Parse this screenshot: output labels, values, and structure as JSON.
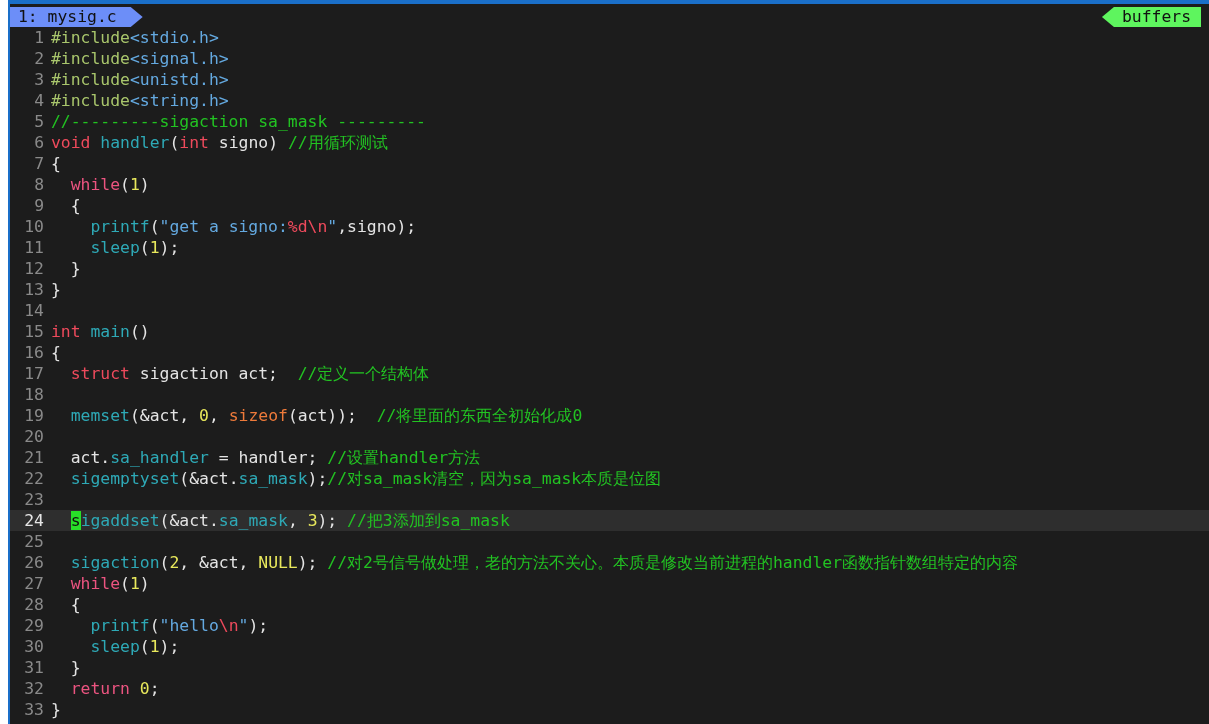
{
  "tabline": {
    "tabs": [
      {
        "label": "1: mysig.c",
        "selected": true
      }
    ],
    "buffers_label": "buffers"
  },
  "lines": [
    {
      "number": "1",
      "current": false,
      "tokens": [
        {
          "kind": "preproc",
          "text": "#include"
        },
        {
          "kind": "string",
          "text": "<stdio.h>"
        }
      ]
    },
    {
      "number": "2",
      "current": false,
      "tokens": [
        {
          "kind": "preproc",
          "text": "#include"
        },
        {
          "kind": "string",
          "text": "<signal.h>"
        }
      ]
    },
    {
      "number": "3",
      "current": false,
      "tokens": [
        {
          "kind": "preproc",
          "text": "#include"
        },
        {
          "kind": "string",
          "text": "<unistd.h>"
        }
      ]
    },
    {
      "number": "4",
      "current": false,
      "tokens": [
        {
          "kind": "preproc",
          "text": "#include"
        },
        {
          "kind": "string",
          "text": "<string.h>"
        }
      ]
    },
    {
      "number": "5",
      "current": false,
      "tokens": [
        {
          "kind": "comment",
          "text": "//---------sigaction sa_mask ---------"
        }
      ]
    },
    {
      "number": "6",
      "current": false,
      "tokens": [
        {
          "kind": "type",
          "text": "void"
        },
        {
          "kind": "func",
          "text": " handler"
        },
        {
          "kind": "plain",
          "text": "("
        },
        {
          "kind": "type",
          "text": "int"
        },
        {
          "kind": "plain",
          "text": " signo) "
        },
        {
          "kind": "comment",
          "text": "//用循环测试"
        }
      ]
    },
    {
      "number": "7",
      "current": false,
      "tokens": [
        {
          "kind": "plain",
          "text": "{"
        }
      ]
    },
    {
      "number": "8",
      "current": false,
      "tokens": [
        {
          "kind": "keyword",
          "text": "  while"
        },
        {
          "kind": "plain",
          "text": "("
        },
        {
          "kind": "number",
          "text": "1"
        },
        {
          "kind": "plain",
          "text": ")"
        }
      ]
    },
    {
      "number": "9",
      "current": false,
      "tokens": [
        {
          "kind": "plain",
          "text": "  {"
        }
      ]
    },
    {
      "number": "10",
      "current": false,
      "tokens": [
        {
          "kind": "func",
          "text": "    printf"
        },
        {
          "kind": "plain",
          "text": "("
        },
        {
          "kind": "string",
          "text": "\"get a signo:"
        },
        {
          "kind": "escape",
          "text": "%d\\n"
        },
        {
          "kind": "string",
          "text": "\""
        },
        {
          "kind": "plain",
          "text": ",signo);"
        }
      ]
    },
    {
      "number": "11",
      "current": false,
      "tokens": [
        {
          "kind": "func",
          "text": "    sleep"
        },
        {
          "kind": "plain",
          "text": "("
        },
        {
          "kind": "number",
          "text": "1"
        },
        {
          "kind": "plain",
          "text": ");"
        }
      ]
    },
    {
      "number": "12",
      "current": false,
      "tokens": [
        {
          "kind": "plain",
          "text": "  }"
        }
      ]
    },
    {
      "number": "13",
      "current": false,
      "tokens": [
        {
          "kind": "plain",
          "text": "}"
        }
      ]
    },
    {
      "number": "14",
      "current": false
    },
    {
      "number": "15",
      "current": false,
      "tokens": [
        {
          "kind": "type",
          "text": "int"
        },
        {
          "kind": "func",
          "text": " main"
        },
        {
          "kind": "plain",
          "text": "()"
        }
      ]
    },
    {
      "number": "16",
      "current": false,
      "tokens": [
        {
          "kind": "plain",
          "text": "{"
        }
      ]
    },
    {
      "number": "17",
      "current": false,
      "tokens": [
        {
          "kind": "type",
          "text": "  struct"
        },
        {
          "kind": "plain",
          "text": " sigaction act;  "
        },
        {
          "kind": "comment",
          "text": "//定义一个结构体"
        }
      ]
    },
    {
      "number": "18",
      "current": false
    },
    {
      "number": "19",
      "current": false,
      "tokens": [
        {
          "kind": "func",
          "text": "  memset"
        },
        {
          "kind": "plain",
          "text": "(&act, "
        },
        {
          "kind": "number",
          "text": "0"
        },
        {
          "kind": "plain",
          "text": ", "
        },
        {
          "kind": "operator",
          "text": "sizeof"
        },
        {
          "kind": "plain",
          "text": "(act));  "
        },
        {
          "kind": "comment",
          "text": "//将里面的东西全初始化成0"
        }
      ]
    },
    {
      "number": "20",
      "current": false
    },
    {
      "number": "21",
      "current": false,
      "tokens": [
        {
          "kind": "plain",
          "text": "  act."
        },
        {
          "kind": "field",
          "text": "sa_handler"
        },
        {
          "kind": "plain",
          "text": " = handler; "
        },
        {
          "kind": "comment",
          "text": "//设置handler方法"
        }
      ]
    },
    {
      "number": "22",
      "current": false,
      "tokens": [
        {
          "kind": "func",
          "text": "  sigemptyset"
        },
        {
          "kind": "plain",
          "text": "(&act."
        },
        {
          "kind": "field",
          "text": "sa_mask"
        },
        {
          "kind": "plain",
          "text": ");"
        },
        {
          "kind": "comment",
          "text": "//对sa_mask清空，因为sa_mask本质是位图"
        }
      ]
    },
    {
      "number": "23",
      "current": false
    },
    {
      "number": "24",
      "current": true,
      "tokens": [
        {
          "kind": "cursor",
          "text": "s"
        },
        {
          "kind": "func",
          "text": "igaddset"
        },
        {
          "kind": "plain",
          "text": "(&act."
        },
        {
          "kind": "field",
          "text": "sa_mask"
        },
        {
          "kind": "plain",
          "text": ", "
        },
        {
          "kind": "number",
          "text": "3"
        },
        {
          "kind": "plain",
          "text": "); "
        },
        {
          "kind": "comment",
          "text": "//把3添加到sa_mask"
        }
      ]
    },
    {
      "number": "25",
      "current": false
    },
    {
      "number": "26",
      "current": false,
      "tokens": [
        {
          "kind": "func",
          "text": "  sigaction"
        },
        {
          "kind": "plain",
          "text": "("
        },
        {
          "kind": "number",
          "text": "2"
        },
        {
          "kind": "plain",
          "text": ", &act, "
        },
        {
          "kind": "number",
          "text": "NULL"
        },
        {
          "kind": "plain",
          "text": "); "
        },
        {
          "kind": "comment",
          "text": "//对2号信号做处理，老的方法不关心。本质是修改当前进程的handler函数指针数组特定的内容"
        }
      ]
    },
    {
      "number": "27",
      "current": false,
      "tokens": [
        {
          "kind": "keyword",
          "text": "  while"
        },
        {
          "kind": "plain",
          "text": "("
        },
        {
          "kind": "number",
          "text": "1"
        },
        {
          "kind": "plain",
          "text": ")"
        }
      ]
    },
    {
      "number": "28",
      "current": false,
      "tokens": [
        {
          "kind": "plain",
          "text": "  {"
        }
      ]
    },
    {
      "number": "29",
      "current": false,
      "tokens": [
        {
          "kind": "func",
          "text": "    printf"
        },
        {
          "kind": "plain",
          "text": "("
        },
        {
          "kind": "string",
          "text": "\"hello"
        },
        {
          "kind": "escape",
          "text": "\\n"
        },
        {
          "kind": "string",
          "text": "\""
        },
        {
          "kind": "plain",
          "text": ");"
        }
      ]
    },
    {
      "number": "30",
      "current": false,
      "tokens": [
        {
          "kind": "func",
          "text": "    sleep"
        },
        {
          "kind": "plain",
          "text": "("
        },
        {
          "kind": "number",
          "text": "1"
        },
        {
          "kind": "plain",
          "text": ");"
        }
      ]
    },
    {
      "number": "31",
      "current": false,
      "tokens": [
        {
          "kind": "plain",
          "text": "  }"
        }
      ]
    },
    {
      "number": "32",
      "current": false,
      "tokens": [
        {
          "kind": "keyword",
          "text": "  return"
        },
        {
          "kind": "number",
          "text": " 0"
        },
        {
          "kind": "plain",
          "text": ";"
        }
      ]
    },
    {
      "number": "33",
      "current": false,
      "tokens": [
        {
          "kind": "plain",
          "text": "}"
        }
      ]
    }
  ]
}
